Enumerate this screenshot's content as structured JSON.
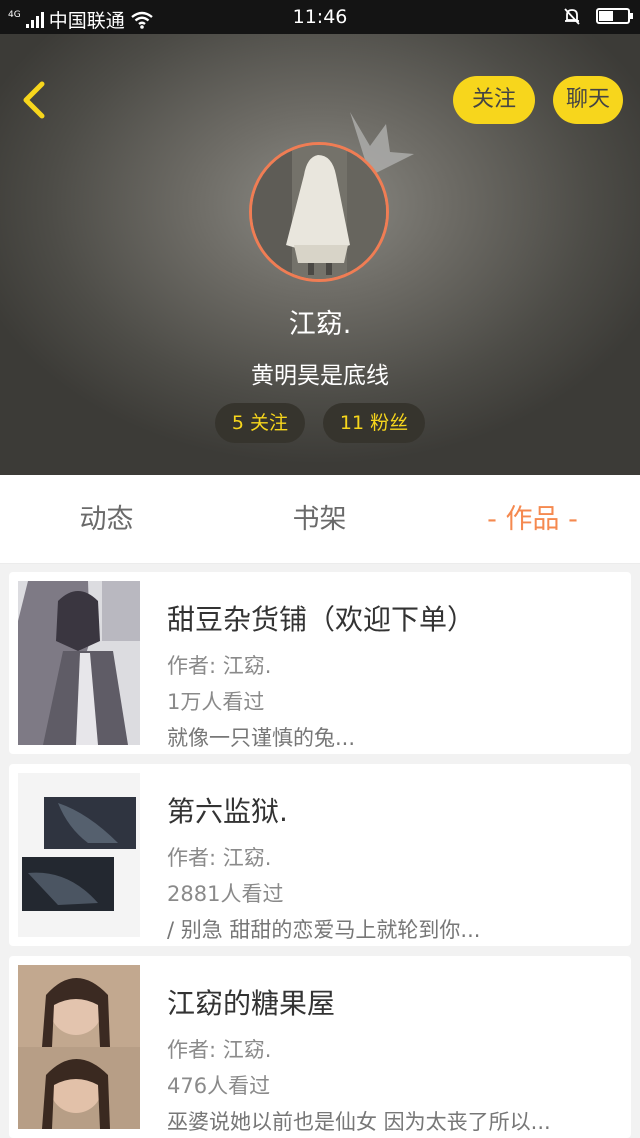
{
  "status_bar": {
    "network": "4G",
    "carrier": "中国联通",
    "time": "11:46",
    "battery_level": 0.5
  },
  "header": {
    "follow_label": "关注",
    "chat_label": "聊天",
    "username": "江窈.",
    "signature": "黄明昊是底线",
    "following_count_label": "5 关注",
    "fans_count_label": "11 粉丝",
    "accent_color": "#f7d61c",
    "avatar_ring_color": "#f07d54"
  },
  "tabs": [
    {
      "label": "动态"
    },
    {
      "label": "书架"
    },
    {
      "label": "- 作品 -",
      "active": true
    }
  ],
  "works": [
    {
      "title": "甜豆杂货铺（欢迎下单）",
      "author": "作者: 江窈.",
      "views": "1万人看过",
      "excerpt": "就像一只谨慎的兔..."
    },
    {
      "title": "第六监狱.",
      "author": "作者: 江窈.",
      "views": "2881人看过",
      "excerpt": "/ 别急 甜甜的恋爱马上就轮到你..."
    },
    {
      "title": "江窈的糖果屋",
      "author": "作者: 江窈.",
      "views": "476人看过",
      "excerpt": "巫婆说她以前也是仙女 因为太丧了所以..."
    }
  ]
}
